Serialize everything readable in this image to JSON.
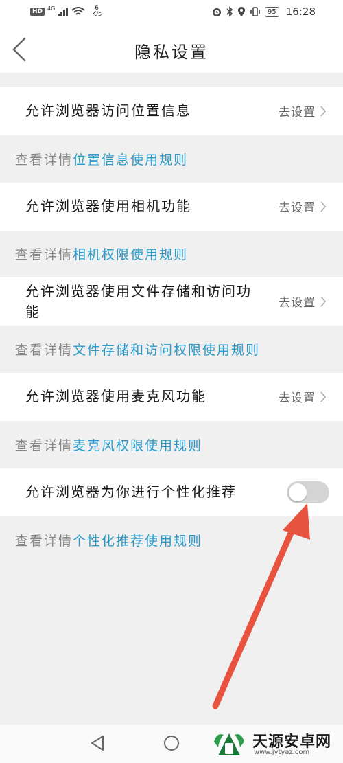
{
  "status_bar": {
    "hd": "HD",
    "network_gen": "4G",
    "speed_value": "6",
    "speed_unit": "K/s",
    "battery": "95",
    "time": "16:28"
  },
  "header": {
    "title": "隐私设置"
  },
  "settings": [
    {
      "label": "允许浏览器访问位置信息",
      "action": "去设置",
      "detail_prefix": "查看详情",
      "detail_link": "位置信息使用规则"
    },
    {
      "label": "允许浏览器使用相机功能",
      "action": "去设置",
      "detail_prefix": "查看详情",
      "detail_link": "相机权限使用规则"
    },
    {
      "label": "允许浏览器使用文件存储和访问功能",
      "action": "去设置",
      "detail_prefix": "查看详情",
      "detail_link": "文件存储和访问权限使用规则"
    },
    {
      "label": "允许浏览器使用麦克风功能",
      "action": "去设置",
      "detail_prefix": "查看详情",
      "detail_link": "麦克风权限使用规则"
    },
    {
      "label": "允许浏览器为你进行个性化推荐",
      "toggle_on": false,
      "detail_prefix": "查看详情",
      "detail_link": "个性化推荐使用规则"
    }
  ],
  "colors": {
    "link": "#2a9bc9",
    "annotation_arrow": "#e8533f",
    "toggle_off": "#d4d4d4"
  },
  "watermark": {
    "name": "天源安卓网",
    "url": "www.jytyaz.com"
  }
}
